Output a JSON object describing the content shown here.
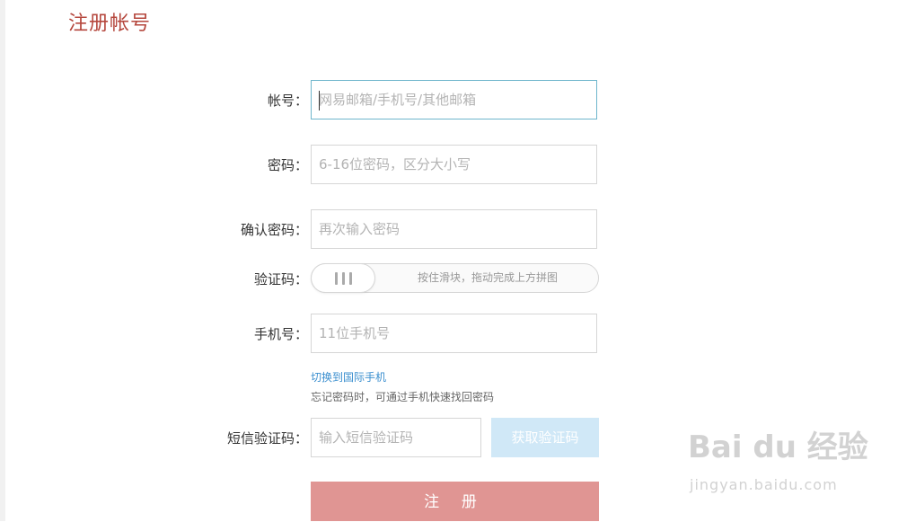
{
  "page": {
    "title": "注册帐号"
  },
  "form": {
    "account": {
      "label": "帐号：",
      "placeholder": "网易邮箱/手机号/其他邮箱"
    },
    "password": {
      "label": "密码：",
      "placeholder": "6-16位密码，区分大小写"
    },
    "confirm_password": {
      "label": "确认密码：",
      "placeholder": "再次输入密码"
    },
    "captcha": {
      "label": "验证码：",
      "slider_hint": "按住滑块，拖动完成上方拼图"
    },
    "phone": {
      "label": "手机号：",
      "placeholder": "11位手机号"
    },
    "switch_international": "切换到国际手机",
    "phone_note": "忘记密码时，可通过手机快速找回密码",
    "sms_code": {
      "label": "短信验证码：",
      "placeholder": "输入短信验证码",
      "button": "获取验证码"
    },
    "submit": "注 册"
  },
  "watermark": {
    "logo": "Bai du 经验",
    "sub": "jingyan.baidu.com"
  }
}
